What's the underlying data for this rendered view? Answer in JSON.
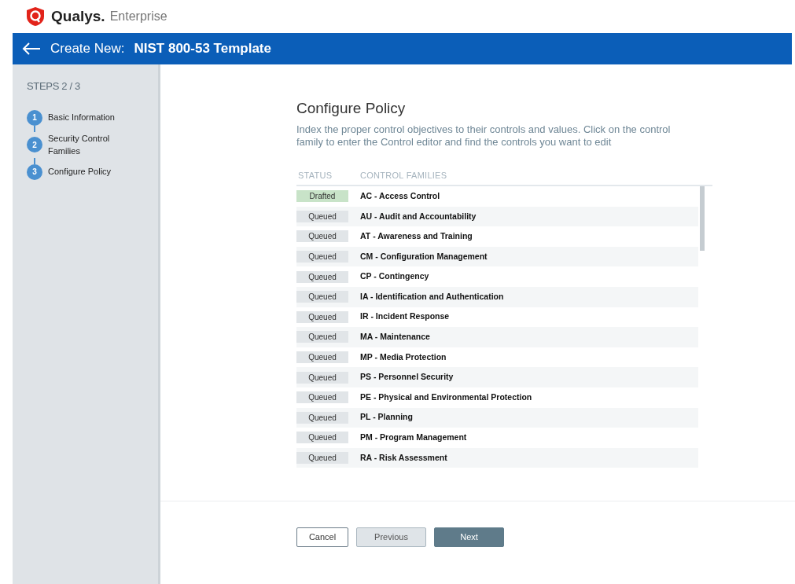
{
  "brand": {
    "name": "Qualys.",
    "product": "Enterprise"
  },
  "header": {
    "prefix": "Create New:",
    "title": "NIST 800-53 Template"
  },
  "sidebar": {
    "steps_label": "STEPS 2 / 3",
    "steps": [
      {
        "number": "1",
        "label": "Basic Information"
      },
      {
        "number": "2",
        "label": "Security Control Families"
      },
      {
        "number": "3",
        "label": "Configure Policy"
      }
    ]
  },
  "main": {
    "title": "Configure Policy",
    "description": "Index the proper control objectives to their controls and values. Click on the control family to enter the Control editor and find the controls you want to edit",
    "table": {
      "columns": [
        "STATUS",
        "CONTROL FAMILIES"
      ],
      "rows": [
        {
          "status": "Drafted",
          "kind": "drafted",
          "family": "AC - Access Control"
        },
        {
          "status": "Queued",
          "kind": "queued",
          "family": "AU - Audit and Accountability"
        },
        {
          "status": "Queued",
          "kind": "queued",
          "family": "AT - Awareness and Training"
        },
        {
          "status": "Queued",
          "kind": "queued",
          "family": "CM - Configuration Management"
        },
        {
          "status": "Queued",
          "kind": "queued",
          "family": "CP - Contingency"
        },
        {
          "status": "Queued",
          "kind": "queued",
          "family": "IA - Identification and Authentication"
        },
        {
          "status": "Queued",
          "kind": "queued",
          "family": "IR - Incident Response"
        },
        {
          "status": "Queued",
          "kind": "queued",
          "family": "MA - Maintenance"
        },
        {
          "status": "Queued",
          "kind": "queued",
          "family": "MP - Media Protection"
        },
        {
          "status": "Queued",
          "kind": "queued",
          "family": "PS - Personnel Security"
        },
        {
          "status": "Queued",
          "kind": "queued",
          "family": "PE - Physical and Environmental Protection"
        },
        {
          "status": "Queued",
          "kind": "queued",
          "family": "PL - Planning"
        },
        {
          "status": "Queued",
          "kind": "queued",
          "family": "PM - Program Management"
        },
        {
          "status": "Queued",
          "kind": "queued",
          "family": "RA - Risk Assessment"
        }
      ]
    }
  },
  "buttons": [
    {
      "label": "Cancel",
      "kind": "outline"
    },
    {
      "label": "Previous",
      "kind": "secondary"
    },
    {
      "label": "Next",
      "kind": "primary"
    }
  ]
}
